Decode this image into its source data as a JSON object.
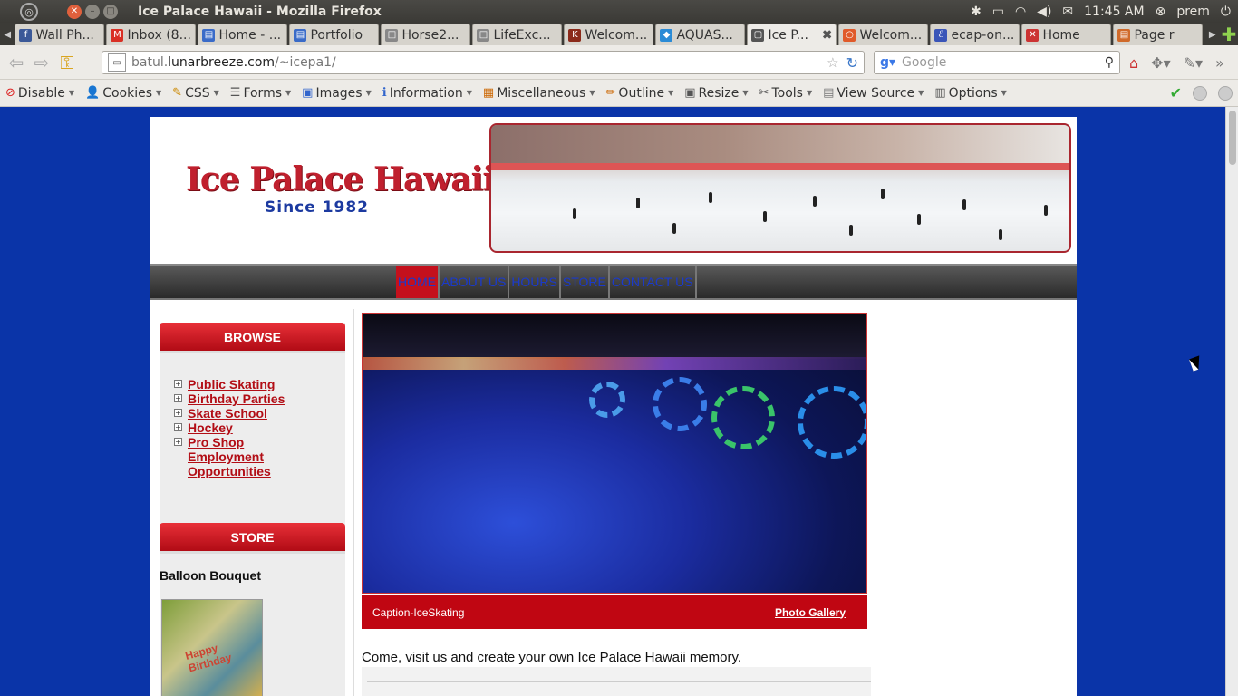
{
  "window": {
    "title": "Ice Palace Hawaii - Mozilla Firefox"
  },
  "tray": {
    "time": "11:45 AM",
    "user": "prem"
  },
  "tabs": [
    {
      "label": "Wall Ph...",
      "icon": "facebook-icon",
      "color": "#3b5998",
      "glyph": "f"
    },
    {
      "label": "Inbox (8...",
      "icon": "gmail-icon",
      "color": "#d93025",
      "glyph": "M"
    },
    {
      "label": "Home - ...",
      "icon": "page-icon",
      "color": "#3a6bc8",
      "glyph": "▤"
    },
    {
      "label": "Portfolio",
      "icon": "page-icon",
      "color": "#3a6bc8",
      "glyph": "▤"
    },
    {
      "label": "Horse2...",
      "icon": "blank-page-icon",
      "color": "#888888",
      "glyph": "□"
    },
    {
      "label": "LifeExc...",
      "icon": "blank-page-icon",
      "color": "#888888",
      "glyph": "□"
    },
    {
      "label": "Welcom...",
      "icon": "ko-icon",
      "color": "#8b2a1a",
      "glyph": "K"
    },
    {
      "label": "AQUAS...",
      "icon": "aquas-icon",
      "color": "#2a8bd6",
      "glyph": "◆"
    },
    {
      "label": "Ice P...",
      "icon": "page-icon",
      "color": "#555555",
      "glyph": "▢",
      "active": true
    },
    {
      "label": "Welcom...",
      "icon": "ubuntu-icon",
      "color": "#e05a2a",
      "glyph": "○"
    },
    {
      "label": "ecap-on...",
      "icon": "eclipse-icon",
      "color": "#3a55b8",
      "glyph": "ℰ"
    },
    {
      "label": "Home",
      "icon": "joomla-icon",
      "color": "#c33",
      "glyph": "✕"
    },
    {
      "label": "Page r",
      "icon": "page-icon",
      "color": "#d06a2a",
      "glyph": "▤"
    }
  ],
  "urlbar": {
    "domain_prefix": "batul.",
    "domain": "lunarbreeze.com",
    "path": "/~icepa1/"
  },
  "search": {
    "placeholder": "Google"
  },
  "devbar": [
    {
      "label": "Disable",
      "icon": "disable-icon",
      "glyph": "⊘",
      "color": "#d22"
    },
    {
      "label": "Cookies",
      "icon": "cookies-icon",
      "glyph": "👤",
      "color": "#333"
    },
    {
      "label": "CSS",
      "icon": "css-icon",
      "glyph": "✎",
      "color": "#c80"
    },
    {
      "label": "Forms",
      "icon": "forms-icon",
      "glyph": "☰",
      "color": "#555"
    },
    {
      "label": "Images",
      "icon": "images-icon",
      "glyph": "▣",
      "color": "#36c"
    },
    {
      "label": "Information",
      "icon": "information-icon",
      "glyph": "ℹ",
      "color": "#36c"
    },
    {
      "label": "Miscellaneous",
      "icon": "miscellaneous-icon",
      "glyph": "▦",
      "color": "#c60"
    },
    {
      "label": "Outline",
      "icon": "outline-icon",
      "glyph": "✏",
      "color": "#c60"
    },
    {
      "label": "Resize",
      "icon": "resize-icon",
      "glyph": "▣",
      "color": "#555"
    },
    {
      "label": "Tools",
      "icon": "tools-icon",
      "glyph": "✂",
      "color": "#555"
    },
    {
      "label": "View Source",
      "icon": "view-source-icon",
      "glyph": "▤",
      "color": "#777"
    },
    {
      "label": "Options",
      "icon": "options-icon",
      "glyph": "▥",
      "color": "#555"
    }
  ],
  "site": {
    "logo_title": "Ice Palace Hawaii",
    "logo_sub": "Since 1982",
    "nav": [
      "HOME",
      "ABOUT US",
      "HOURS",
      "STORE",
      "CONTACT US"
    ],
    "browse_heading": "BROWSE",
    "browse_links": [
      {
        "label": "Public Skating",
        "expandable": true
      },
      {
        "label": "Birthday Parties",
        "expandable": true
      },
      {
        "label": "Skate School",
        "expandable": true
      },
      {
        "label": "Hockey",
        "expandable": true
      },
      {
        "label": "Pro Shop",
        "expandable": true
      },
      {
        "label": "Employment Opportunities",
        "expandable": false
      }
    ],
    "store_heading": "STORE",
    "store_item": "Balloon Bouquet",
    "store_img_text": "Happy Birthday",
    "caption": "Caption-IceSkating",
    "gallery_link": "Photo Gallery",
    "intro": "Come, visit us and create your own Ice Palace Hawaii memory."
  },
  "colors": {
    "page_bg": "#0a34a8",
    "brand_red": "#c00612",
    "nav_link": "#1a3acc"
  }
}
